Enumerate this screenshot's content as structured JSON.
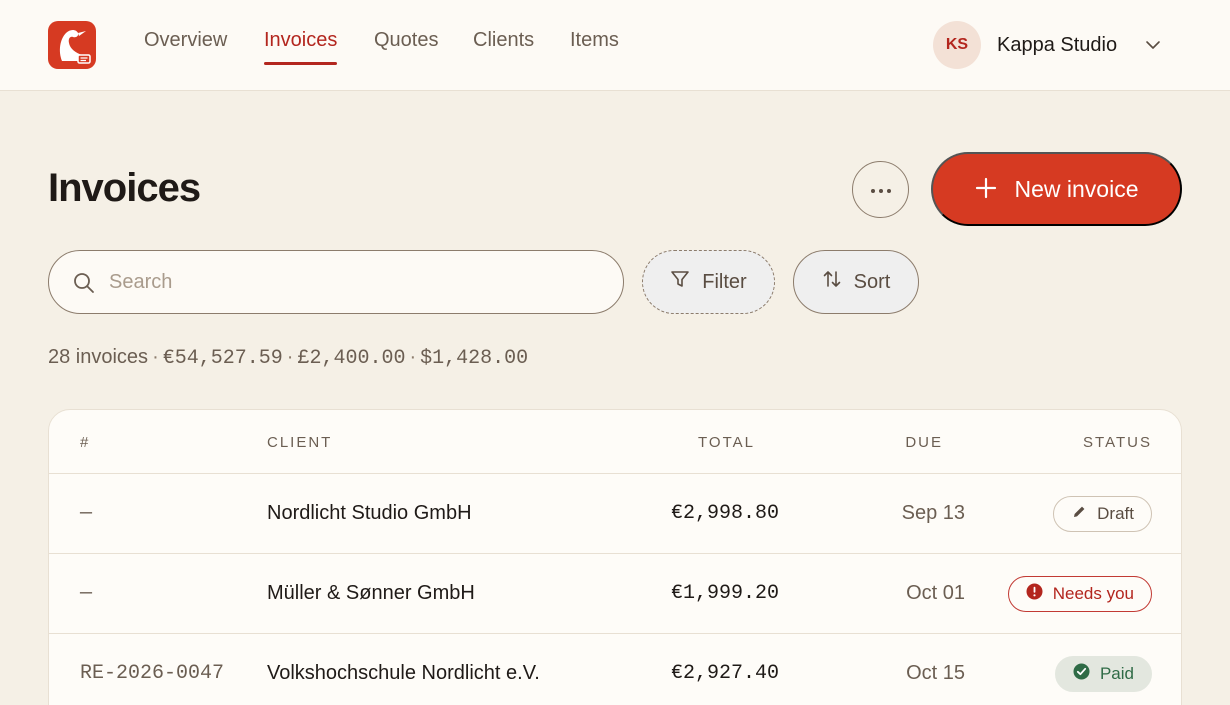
{
  "nav": {
    "items": [
      {
        "label": "Overview",
        "active": false
      },
      {
        "label": "Invoices",
        "active": true
      },
      {
        "label": "Quotes",
        "active": false
      },
      {
        "label": "Clients",
        "active": false
      },
      {
        "label": "Items",
        "active": false
      }
    ]
  },
  "account": {
    "initials": "KS",
    "name": "Kappa Studio"
  },
  "header": {
    "title": "Invoices",
    "new_label": "New invoice"
  },
  "search": {
    "placeholder": "Search",
    "value": ""
  },
  "toolbar": {
    "filter_label": "Filter",
    "sort_label": "Sort"
  },
  "summary": {
    "count_text": "28 invoices",
    "amounts": [
      "€54,527.59",
      "£2,400.00",
      "$1,428.00"
    ]
  },
  "table": {
    "columns": [
      "#",
      "CLIENT",
      "TOTAL",
      "DUE",
      "STATUS"
    ],
    "rows": [
      {
        "number": "—",
        "client": "Nordlicht Studio GmbH",
        "total": "€2,998.80",
        "due": "Sep 13",
        "status": "Draft"
      },
      {
        "number": "—",
        "client": "Müller & Sønner GmbH",
        "total": "€1,999.20",
        "due": "Oct 01",
        "status": "Needs you"
      },
      {
        "number": "RE-2026-0047",
        "client": "Volkshochschule Nordlicht e.V.",
        "total": "€2,927.40",
        "due": "Oct 15",
        "status": "Paid"
      }
    ]
  },
  "colors": {
    "brand": "#d63a22",
    "accent": "#b3261e",
    "background": "#f5f0e6",
    "paid": "#2f6b46"
  },
  "icons": [
    "logo-icon",
    "chevron-down-icon",
    "more-icon",
    "plus-icon",
    "search-icon",
    "filter-icon",
    "sort-icon",
    "pencil-icon",
    "alert-icon",
    "check-circle-icon"
  ]
}
